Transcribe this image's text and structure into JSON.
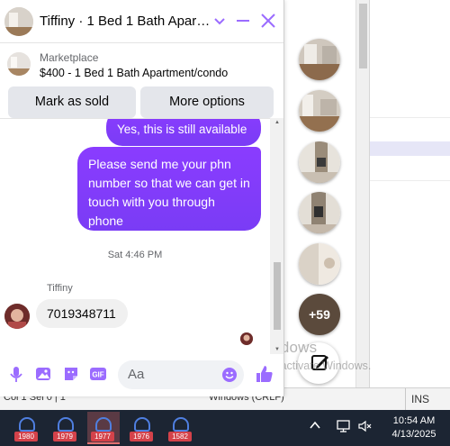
{
  "conversation": {
    "title": "Tiffiny · 1 Bed 1 Bath Apart...",
    "product_label": "Marketplace",
    "product_title": "$400 - 1 Bed 1 Bath Apartment/condo"
  },
  "actions": {
    "mark_sold": "Mark as sold",
    "more_options": "More options"
  },
  "messages": {
    "partial_message": "Yes, this is still available",
    "outgoing_message": "Please send me your phn number so that we can get in touch with you through phone",
    "timestamp": "Sat 4:46 PM",
    "sender_name": "Tiffiny",
    "incoming_message": "7019348711"
  },
  "composer": {
    "placeholder": "Aa"
  },
  "chat_heads": {
    "more_count": "+59"
  },
  "watermark": {
    "line1": "Activate Windows",
    "line2": "Go to Settings to activate Windows."
  },
  "statusbar": {
    "left_text": "Col 1  Sel 0 | 1",
    "encoding": "Windows (CRLF)",
    "ins": "INS"
  },
  "taskbar": {
    "badges": [
      "1980",
      "1979",
      "1977",
      "1976",
      "1582"
    ],
    "time": "10:54 AM",
    "date": "4/13/2025"
  },
  "colors": {
    "accent": "#8a3cff",
    "icon_purple": "#9b6cff",
    "taskbar": "#1c2533",
    "badge": "#d4424a"
  }
}
